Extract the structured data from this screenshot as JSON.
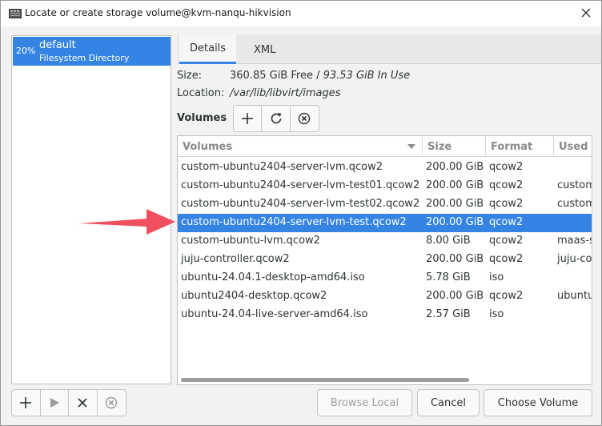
{
  "window": {
    "title": "Locate or create storage volume@kvm-nanqu-hikvision",
    "app_icon": "virt-manager-icon",
    "close_icon": "close-icon"
  },
  "pools": [
    {
      "percent": "20%",
      "name": "default",
      "type": "Filesystem Directory",
      "selected": true
    }
  ],
  "tabs": [
    {
      "label": "Details",
      "active": true
    },
    {
      "label": "XML",
      "active": false
    }
  ],
  "details": {
    "size_label": "Size:",
    "size_free": "360.85 GiB Free",
    "size_sep": " / ",
    "size_in_use": "93.53 GiB In Use",
    "location_label": "Location:",
    "location_value": "/var/lib/libvirt/images",
    "volumes_label": "Volumes"
  },
  "volume_toolbar": {
    "add_icon": "plus-icon",
    "refresh_icon": "refresh-icon",
    "delete_icon": "delete-circle-icon"
  },
  "table": {
    "columns": [
      "Volumes",
      "Size",
      "Format",
      "Used"
    ],
    "rows": [
      {
        "name": "custom-ubuntu2404-server-lvm.qcow2",
        "size": "200.00 GiB",
        "format": "qcow2",
        "used": ""
      },
      {
        "name": "custom-ubuntu2404-server-lvm-test01.qcow2",
        "size": "200.00 GiB",
        "format": "qcow2",
        "used": "custom"
      },
      {
        "name": "custom-ubuntu2404-server-lvm-test02.qcow2",
        "size": "200.00 GiB",
        "format": "qcow2",
        "used": "custom"
      },
      {
        "name": "custom-ubuntu2404-server-lvm-test.qcow2",
        "size": "200.00 GiB",
        "format": "qcow2",
        "used": "",
        "selected": true
      },
      {
        "name": "custom-ubuntu-lvm.qcow2",
        "size": "8.00 GiB",
        "format": "qcow2",
        "used": "maas-s"
      },
      {
        "name": "juju-controller.qcow2",
        "size": "200.00 GiB",
        "format": "qcow2",
        "used": "juju-co"
      },
      {
        "name": "ubuntu-24.04.1-desktop-amd64.iso",
        "size": "5.78 GiB",
        "format": "iso",
        "used": ""
      },
      {
        "name": "ubuntu2404-desktop.qcow2",
        "size": "200.00 GiB",
        "format": "qcow2",
        "used": "ubuntu"
      },
      {
        "name": "ubuntu-24.04-live-server-amd64.iso",
        "size": "2.57 GiB",
        "format": "iso",
        "used": ""
      }
    ]
  },
  "pool_toolbar": {
    "add_icon": "plus-icon",
    "start_icon": "play-icon",
    "stop_icon": "x-icon",
    "delete_icon": "delete-circle-icon"
  },
  "buttons": {
    "browse_local": "Browse Local",
    "cancel": "Cancel",
    "choose_volume": "Choose Volume"
  },
  "colors": {
    "selection": "#3584e4",
    "annotation_arrow": "#f0505e"
  }
}
